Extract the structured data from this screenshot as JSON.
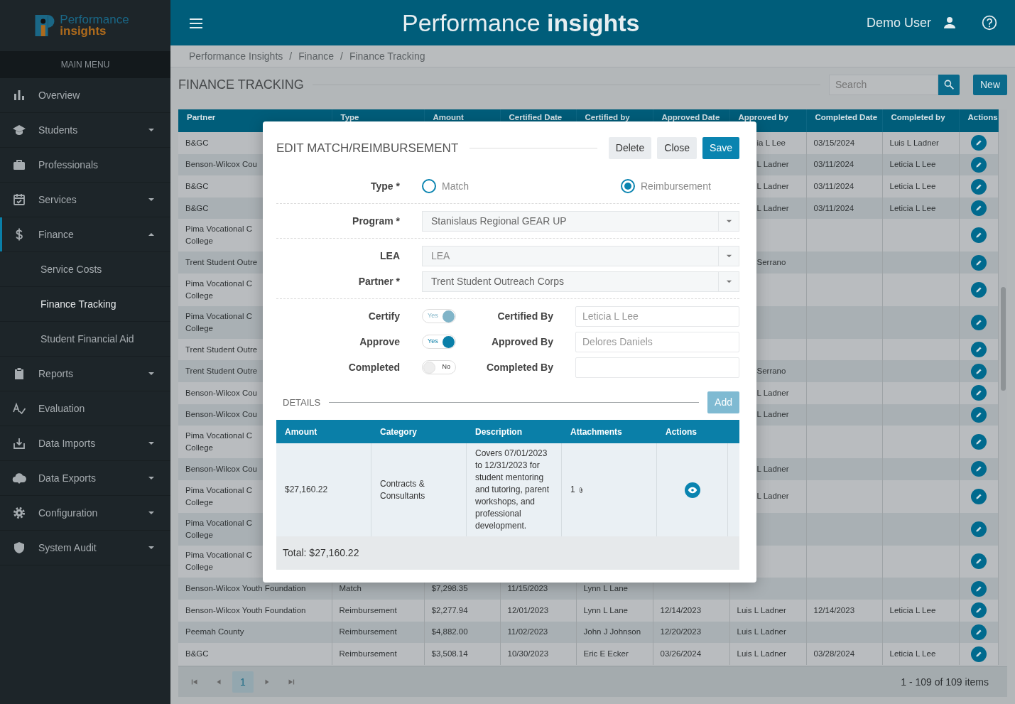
{
  "sidebar": {
    "logo": {
      "line1": "Performance",
      "line2": "insights"
    },
    "heading": "MAIN MENU",
    "items": [
      {
        "label": "Overview",
        "selected": false
      },
      {
        "label": "Students",
        "selected": false,
        "expanded": false
      },
      {
        "label": "Professionals",
        "selected": false
      },
      {
        "label": "Services",
        "selected": false,
        "expanded": false
      },
      {
        "label": "Finance",
        "selected": true,
        "expanded": true,
        "children": [
          {
            "label": "Service Costs",
            "selected": false
          },
          {
            "label": "Finance Tracking",
            "selected": true
          },
          {
            "label": "Student Financial Aid",
            "selected": false
          }
        ]
      },
      {
        "label": "Reports",
        "selected": false,
        "expanded": false
      },
      {
        "label": "Evaluation",
        "selected": false
      },
      {
        "label": "Data Imports",
        "selected": false,
        "expanded": false
      },
      {
        "label": "Data Exports",
        "selected": false,
        "expanded": false
      },
      {
        "label": "Configuration",
        "selected": false,
        "expanded": false
      },
      {
        "label": "System Audit",
        "selected": false,
        "expanded": false
      }
    ]
  },
  "topbar": {
    "title": "Performance **insights**",
    "user": "Demo User"
  },
  "breadcrumb": {
    "separator": "/",
    "items": [
      "Performance Insights",
      "Finance",
      "Finance Tracking"
    ]
  },
  "page": {
    "title": "FINANCE TRACKING",
    "search": {
      "placeholder": "Search"
    },
    "new_button": "New"
  },
  "table": {
    "columns": [
      "Partner",
      "Type",
      "Amount",
      "Certified Date",
      "Certified by",
      "Approved Date",
      "Approved by",
      "Completed Date",
      "Completed by",
      "Actions"
    ],
    "rows": [
      {
        "cells": [
          "B&GC",
          null,
          null,
          null,
          null,
          null,
          "ia L Lee",
          "03/15/2024",
          "Luis L Ladner"
        ]
      },
      {
        "cells": [
          "Benson-Wilcox Cou",
          null,
          null,
          null,
          null,
          null,
          "L Ladner",
          "03/11/2024",
          "Leticia L Lee"
        ]
      },
      {
        "cells": [
          "B&GC",
          null,
          null,
          null,
          null,
          null,
          "L Ladner",
          "03/11/2024",
          "Leticia L Lee"
        ]
      },
      {
        "cells": [
          "B&GC",
          null,
          null,
          null,
          null,
          null,
          "L Ladner",
          "03/11/2024",
          "Leticia L Lee"
        ]
      },
      {
        "cells": [
          "Pima Vocational C\nCollege",
          null,
          null,
          null,
          null,
          null,
          null,
          null,
          null
        ]
      },
      {
        "cells": [
          "Trent Student Outre",
          null,
          null,
          null,
          null,
          null,
          "Serrano",
          null,
          null
        ]
      },
      {
        "cells": [
          "Pima Vocational C\nCollege",
          null,
          null,
          null,
          null,
          null,
          null,
          null,
          null
        ]
      },
      {
        "cells": [
          "Pima Vocational C\nCollege",
          null,
          null,
          null,
          null,
          null,
          null,
          null,
          null
        ]
      },
      {
        "cells": [
          "Trent Student Outre",
          null,
          null,
          null,
          null,
          null,
          null,
          null,
          null
        ]
      },
      {
        "cells": [
          "Trent Student Outre",
          null,
          null,
          null,
          null,
          null,
          "Serrano",
          null,
          null
        ]
      },
      {
        "cells": [
          "Benson-Wilcox Cou",
          null,
          null,
          null,
          null,
          null,
          "L Ladner",
          null,
          null
        ]
      },
      {
        "cells": [
          "Benson-Wilcox Cou",
          null,
          null,
          null,
          null,
          null,
          "L Ladner",
          null,
          null
        ]
      },
      {
        "cells": [
          "Pima Vocational C\nCollege",
          null,
          null,
          null,
          null,
          null,
          null,
          null,
          null
        ]
      },
      {
        "cells": [
          "Benson-Wilcox Cou",
          null,
          null,
          null,
          null,
          null,
          "L Ladner",
          null,
          null
        ]
      },
      {
        "cells": [
          "Pima Vocational C\nCollege",
          null,
          null,
          null,
          null,
          null,
          "L Ladner",
          null,
          null
        ]
      },
      {
        "cells": [
          "Pima Vocational C\nCollege",
          null,
          null,
          null,
          null,
          null,
          null,
          null,
          null
        ]
      },
      {
        "cells": [
          "Pima Vocational C\nCollege",
          null,
          null,
          null,
          null,
          null,
          null,
          null,
          null
        ]
      },
      {
        "cells": [
          "Benson-Wilcox Youth Foundation",
          "Match",
          "$7,298.35",
          "11/15/2023",
          "Lynn L Lane",
          null,
          null,
          null,
          null
        ]
      },
      {
        "cells": [
          "Benson-Wilcox Youth Foundation",
          "Reimbursement",
          "$2,277.94",
          "12/01/2023",
          "Lynn L Lane",
          "12/14/2023",
          "Luis L Ladner",
          "12/14/2023",
          "Leticia L Lee"
        ]
      },
      {
        "cells": [
          "Peemah County",
          "Reimbursement",
          "$4,882.00",
          "11/02/2023",
          "John J Johnson",
          "12/20/2023",
          "Luis L Ladner",
          null,
          null
        ]
      },
      {
        "cells": [
          "B&GC",
          "Reimbursement",
          "$3,508.14",
          "10/30/2023",
          "Eric E Ecker",
          "03/26/2024",
          "Luis L Ladner",
          "03/28/2024",
          "Leticia L Lee"
        ]
      }
    ],
    "pager": {
      "pages": [
        {
          "label": "1",
          "selected": true
        }
      ],
      "summary": "1 - 109 of 109 items"
    }
  },
  "dialog": {
    "title": "EDIT MATCH/REIMBURSEMENT",
    "buttons": [
      {
        "label": "Delete",
        "kind": "secondary"
      },
      {
        "label": "Close",
        "kind": "secondary"
      },
      {
        "label": "Save",
        "kind": "primary"
      }
    ],
    "type": {
      "label": "Type *",
      "options": [
        {
          "label": "Match",
          "selected": false
        },
        {
          "label": "Reimbursement",
          "selected": true
        }
      ]
    },
    "program": {
      "label": "Program *",
      "value": "Stanislaus Regional GEAR UP"
    },
    "lea": {
      "label": "LEA",
      "placeholder": "LEA"
    },
    "partner": {
      "label": "Partner *",
      "value": "Trent Student Outreach Corps"
    },
    "toggles": [
      {
        "label": "Certify",
        "on": true,
        "disabled": true,
        "text": "Yes",
        "by_label": "Certified By",
        "by_value": "Leticia L Lee"
      },
      {
        "label": "Approve",
        "on": true,
        "disabled": false,
        "text": "Yes",
        "by_label": "Approved By",
        "by_value": "Delores Daniels"
      },
      {
        "label": "Completed",
        "on": false,
        "disabled": false,
        "text": "No",
        "by_label": "Completed By"
      }
    ],
    "details": {
      "title": "DETAILS",
      "add_button": {
        "label": "Add",
        "disabled": true
      },
      "columns": [
        "Amount",
        "Category",
        "Description",
        "Attachments",
        "Actions"
      ],
      "rows": [
        {
          "amount": "$27,160.22",
          "category": "Contracts & Consultants",
          "description": "Covers 07/01/2023 to 12/31/2023 for student mentoring and tutoring, parent workshops, and professional development.",
          "attachments": "1"
        }
      ],
      "total": "Total: $27,160.22"
    }
  }
}
